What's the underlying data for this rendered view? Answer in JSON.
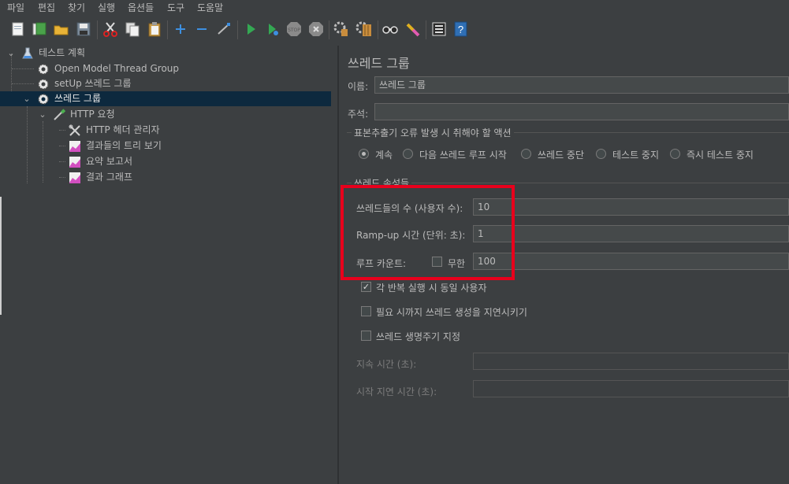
{
  "menubar": [
    "파일",
    "편집",
    "찾기",
    "실행",
    "옵션들",
    "도구",
    "도움말"
  ],
  "toolbar": [
    "new-icon",
    "templates-icon",
    "open-icon",
    "save-icon",
    "cut-icon",
    "copy-icon",
    "paste-icon",
    "expand-icon",
    "collapse-icon",
    "toggle-icon",
    "start-icon",
    "start-no-pause-icon",
    "stop-icon",
    "shutdown-icon",
    "clear-icon",
    "clear-all-icon",
    "search-icon",
    "reset-search-icon",
    "function-helper-icon",
    "help-icon"
  ],
  "tree": {
    "items": [
      {
        "label": "테스트 계획",
        "icon": "flask-icon"
      },
      {
        "label": "Open Model Thread Group",
        "icon": "gear-icon"
      },
      {
        "label": "setUp 쓰레드 그룹",
        "icon": "gear-icon"
      },
      {
        "label": "쓰레드 그룹",
        "icon": "gear-icon"
      },
      {
        "label": "HTTP 요청",
        "icon": "pipette-icon"
      },
      {
        "label": "HTTP 헤더 관리자",
        "icon": "wrench-icon"
      },
      {
        "label": "결과들의 트리 보기",
        "icon": "graph-icon"
      },
      {
        "label": "요약 보고서",
        "icon": "graph-icon"
      },
      {
        "label": "결과 그래프",
        "icon": "graph-icon"
      }
    ]
  },
  "panel": {
    "title": "쓰레드 그룹",
    "name_label": "이름:",
    "name_value": "쓰레드 그룹",
    "comment_label": "주석:",
    "comment_value": "",
    "error_group_title": "표본추출기 오류 발생 시 취해야 할 액션",
    "error_actions": [
      "계속",
      "다음 쓰레드 루프 시작",
      "쓰레드 중단",
      "테스트 중지",
      "즉시 테스트 중지"
    ],
    "selected_action": "계속",
    "props_title": "쓰레드 속성들",
    "threads_label": "쓰레드들의 수 (사용자 수):",
    "threads_value": "10",
    "rampup_label": "Ramp-up 시간 (단위: 초):",
    "rampup_value": "1",
    "loop_label": "루프 카운트:",
    "infinite_label": "무한",
    "infinite_checked": false,
    "loop_value": "100",
    "same_user_label": "각 반복 실행 시 동일 사용자",
    "same_user_checked": true,
    "delay_label": "필요 시까지 쓰레드 생성을 지연시키기",
    "delay_checked": false,
    "lifetime_label": "쓰레드 생명주기 지정",
    "lifetime_checked": false,
    "duration_label": "지속 시간 (초):",
    "duration_value": "",
    "startup_delay_label": "시작 지연 시간 (초):",
    "startup_delay_value": ""
  },
  "colors": {
    "background": "#3c3f41",
    "selection": "#0d293e",
    "highlight": "#e8001c",
    "text": "#bbbbbb"
  }
}
